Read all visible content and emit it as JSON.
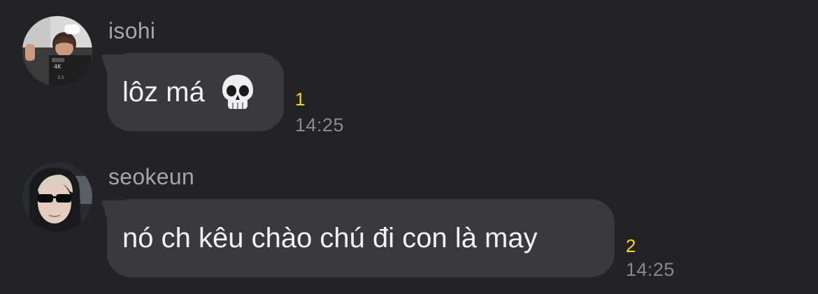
{
  "messages": [
    {
      "sender": "isohi",
      "text": "lôz má",
      "emoji": "skull-emoji",
      "unread_count": "1",
      "time": "14:25"
    },
    {
      "sender": "seokeun",
      "text": "nó ch kêu chào chú đi con là may",
      "unread_count": "2",
      "time": "14:25"
    }
  ],
  "colors": {
    "background": "#232325",
    "bubble": "#3a3a3d",
    "unread": "#f5d90a",
    "time": "#8a8a8e",
    "sender": "#a5a5a8"
  }
}
